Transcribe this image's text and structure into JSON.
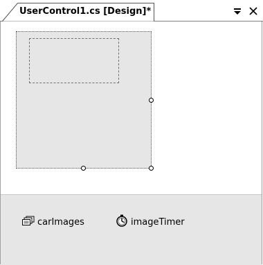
{
  "document": {
    "tab_title": "UserControl1.cs [Design]*"
  },
  "window_controls": {
    "pin_icon": "window-position-icon",
    "close_icon": "close-icon",
    "close_glyph": "✕"
  },
  "designer": {
    "user_control": {
      "selected": true
    },
    "picture_box": {
      "border_style": "dashed"
    }
  },
  "component_tray": {
    "items": [
      {
        "label": "carImages",
        "icon": "imagelist-icon"
      },
      {
        "label": "imageTimer",
        "icon": "timer-icon"
      }
    ]
  },
  "colors": {
    "surface": "#e6e6e6",
    "background": "#ffffff",
    "border": "#808080"
  }
}
